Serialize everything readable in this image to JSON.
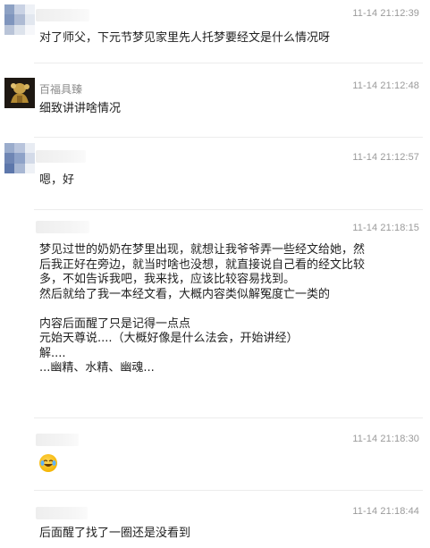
{
  "messages": [
    {
      "name": "",
      "time": "11-14 21:12:39",
      "text": "对了师父，下元节梦见家里先人托梦要经文是什么情况呀"
    },
    {
      "name": "百福具臻",
      "time": "11-14 21:12:48",
      "text": "细致讲讲啥情况"
    },
    {
      "name": "",
      "time": "11-14 21:12:57",
      "text": "嗯，好"
    },
    {
      "name": "",
      "time": "11-14 21:18:15",
      "text": "梦见过世的奶奶在梦里出现，就想让我爷爷弄一些经文给她，然\n后我正好在旁边，就当时啥也没想，就直接说自己看的经文比较\n多，不如告诉我吧，我来找，应该比较容易找到。\n然后就给了我一本经文看，大概内容类似解冤度亡一类的\n\n内容后面醒了只是记得一点点\n元始天尊说....（大概好像是什么法会，开始讲经）\n解....\n...幽精、水精、幽魂..."
    },
    {
      "name": "",
      "time": "11-14 21:18:30",
      "text": "",
      "emoji": "laughing-crying-emoji"
    },
    {
      "name": "",
      "time": "11-14 21:18:44",
      "text": "后面醒了找了一圈还是没看到"
    }
  ],
  "colors": {
    "time": "#9a9a9a",
    "name": "#8c8c8c",
    "text": "#1f1f1f",
    "divider": "#ececec"
  }
}
